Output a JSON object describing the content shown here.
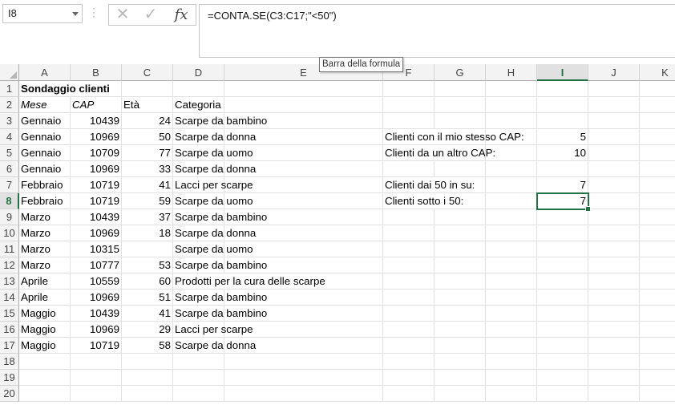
{
  "formula_bar": {
    "name_box": "I8",
    "cancel_icon": "cancel-x-icon",
    "enter_icon": "checkmark-icon",
    "fx_label": "fx",
    "formula": "=CONTA.SE(C3:C17;\"<50\")",
    "tooltip": "Barra della formula"
  },
  "selected": {
    "column": "I",
    "row": 8
  },
  "columns": [
    "A",
    "B",
    "C",
    "D",
    "E",
    "F",
    "G",
    "H",
    "I",
    "J",
    "K"
  ],
  "rows": [
    1,
    2,
    3,
    4,
    5,
    6,
    7,
    8,
    9,
    10,
    11,
    12,
    13,
    14,
    15,
    16,
    17,
    18,
    19,
    20
  ],
  "cells": {
    "A1": "Sondaggio clienti",
    "A2": "Mese",
    "B2": "CAP",
    "C2": "Età",
    "D2": "Categoria",
    "A3": "Gennaio",
    "B3": "10439",
    "C3": "24",
    "D3": "Scarpe da bambino",
    "A4": "Gennaio",
    "B4": "10969",
    "C4": "50",
    "D4": "Scarpe da donna",
    "A5": "Gennaio",
    "B5": "10709",
    "C5": "77",
    "D5": "Scarpe da uomo",
    "A6": "Gennaio",
    "B6": "10969",
    "C6": "33",
    "D6": "Scarpe da donna",
    "A7": "Febbraio",
    "B7": "10719",
    "C7": "41",
    "D7": "Lacci per scarpe",
    "A8": "Febbraio",
    "B8": "10719",
    "C8": "59",
    "D8": "Scarpe da uomo",
    "A9": "Marzo",
    "B9": "10439",
    "C9": "37",
    "D9": "Scarpe da bambino",
    "A10": "Marzo",
    "B10": "10969",
    "C10": "18",
    "D10": "Scarpe da donna",
    "A11": "Marzo",
    "B11": "10315",
    "C11": "",
    "D11": "Scarpe da uomo",
    "A12": "Marzo",
    "B12": "10777",
    "C12": "53",
    "D12": "Scarpe da bambino",
    "A13": "Aprile",
    "B13": "10559",
    "C13": "60",
    "D13": "Prodotti per la cura delle scarpe",
    "A14": "Aprile",
    "B14": "10969",
    "C14": "51",
    "D14": "Scarpe da bambino",
    "A15": "Maggio",
    "B15": "10439",
    "C15": "41",
    "D15": "Scarpe da bambino",
    "A16": "Maggio",
    "B16": "10969",
    "C16": "29",
    "D16": "Lacci per scarpe",
    "A17": "Maggio",
    "B17": "10719",
    "C17": "58",
    "D17": "Scarpe da donna",
    "F4": "Clienti con il mio stesso CAP:",
    "I4": "5",
    "F5": "Clienti da un altro CAP:",
    "I5": "10",
    "F7": "Clienti dai 50 in su:",
    "I7": "7",
    "F8": "Clienti sotto i 50:",
    "I8": "7"
  },
  "colors": {
    "accent": "#217346",
    "gridline": "#e1e1e1",
    "header_bg": "#f3f3f3"
  }
}
